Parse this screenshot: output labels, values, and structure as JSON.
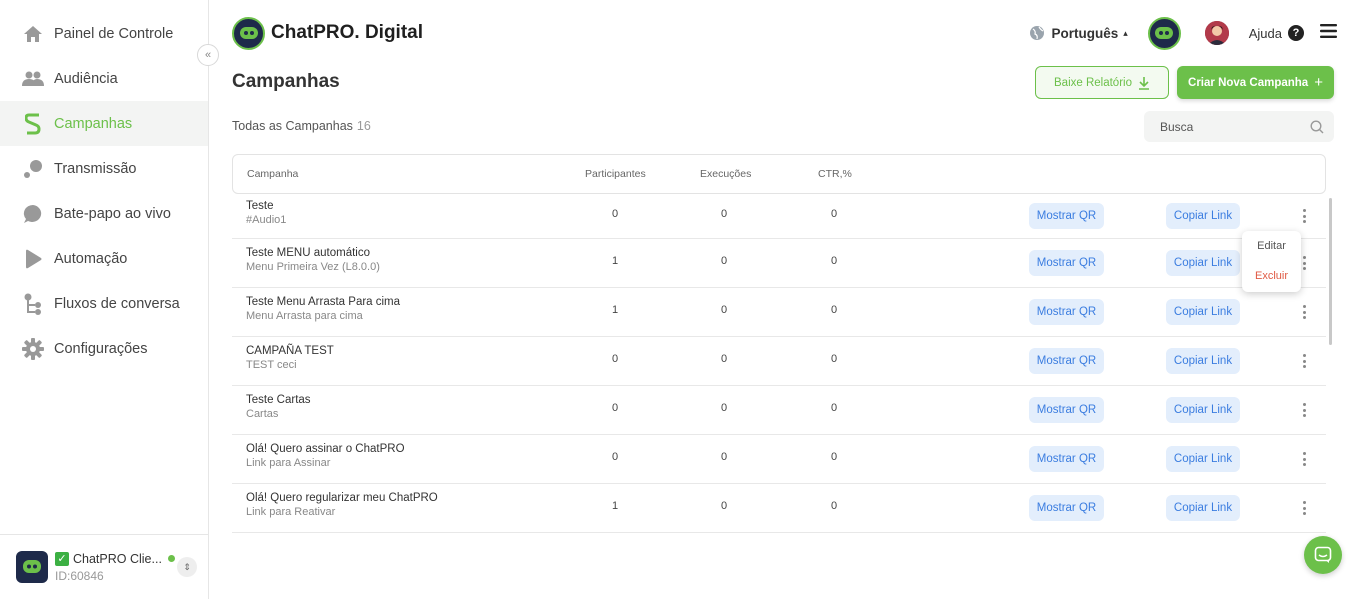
{
  "sidebar": {
    "items": [
      {
        "label": "Painel de Controle",
        "icon": "home-icon"
      },
      {
        "label": "Audiência",
        "icon": "users-icon"
      },
      {
        "label": "Campanhas",
        "icon": "campaign-icon",
        "active": true
      },
      {
        "label": "Transmissão",
        "icon": "broadcast-icon"
      },
      {
        "label": "Bate-papo ao vivo",
        "icon": "chat-bubble-icon"
      },
      {
        "label": "Automação",
        "icon": "automation-icon"
      },
      {
        "label": "Fluxos de conversa",
        "icon": "flow-icon"
      },
      {
        "label": "Configurações",
        "icon": "gear-icon"
      }
    ],
    "collapse_glyph": "«",
    "account": {
      "name": "ChatPRO Clie...",
      "id": "ID:60846",
      "check": "✓",
      "switch_glyph": "⇕"
    }
  },
  "header": {
    "brand": "ChatPRO. Digital",
    "language": "Português",
    "language_caret": "▴",
    "help": "Ajuda",
    "help_glyph": "?"
  },
  "page": {
    "title": "Campanhas",
    "download_button": "Baixe Relatório",
    "create_button": "Criar Nova Campanha",
    "create_glyph": "+",
    "subtitle": "Todas as Campanhas",
    "count": "16",
    "search_placeholder": "Busca"
  },
  "table": {
    "columns": [
      "Campanha",
      "Participantes",
      "Execuções",
      "CTR,%"
    ],
    "qr_label": "Mostrar QR",
    "link_label": "Copiar Link",
    "rows": [
      {
        "name": "Teste",
        "sub": "#Audio1",
        "participants": "0",
        "executions": "0",
        "ctr": "0"
      },
      {
        "name": "Teste MENU automático",
        "sub": "Menu Primeira Vez (L8.0.0)",
        "participants": "1",
        "executions": "0",
        "ctr": "0"
      },
      {
        "name": "Teste Menu Arrasta Para cima",
        "sub": "Menu Arrasta para cima",
        "participants": "1",
        "executions": "0",
        "ctr": "0"
      },
      {
        "name": "CAMPAÑA TEST",
        "sub": "TEST ceci",
        "participants": "0",
        "executions": "0",
        "ctr": "0"
      },
      {
        "name": "Teste Cartas",
        "sub": "Cartas",
        "participants": "0",
        "executions": "0",
        "ctr": "0"
      },
      {
        "name": "Olá! Quero assinar o ChatPRO",
        "sub": "Link para Assinar",
        "participants": "0",
        "executions": "0",
        "ctr": "0"
      },
      {
        "name": "Olá! Quero regularizar meu ChatPRO",
        "sub": "Link para Reativar",
        "participants": "1",
        "executions": "0",
        "ctr": "0"
      }
    ]
  },
  "context_menu": {
    "edit": "Editar",
    "delete": "Excluir"
  },
  "colors": {
    "accent": "#6cc04a",
    "link_blue": "#3b7de0",
    "chip_bg": "#e3eefc",
    "danger": "#e05a44"
  }
}
